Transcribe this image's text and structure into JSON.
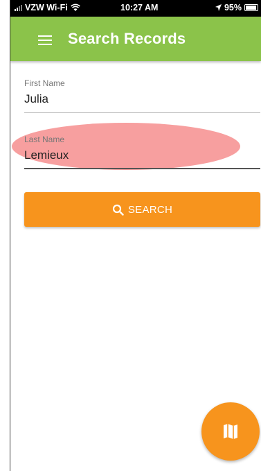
{
  "status_bar": {
    "carrier": "VZW Wi-Fi",
    "time": "10:27 AM",
    "battery": "95%"
  },
  "app_bar": {
    "title": "Search Records",
    "menu_icon": "hamburger-menu-icon",
    "color": "#8bc34a"
  },
  "form": {
    "first_name": {
      "label": "First Name",
      "value": "Julia"
    },
    "last_name": {
      "label": "Last Name",
      "value": "Lemieux"
    }
  },
  "search_button": {
    "label": "SEARCH",
    "icon": "search-icon",
    "color": "#f7941d"
  },
  "fab": {
    "icon": "map-icon",
    "color": "#f7941d"
  }
}
